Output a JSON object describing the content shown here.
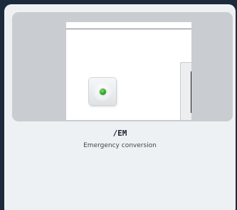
{
  "card": {
    "title": "/EM",
    "subtitle": "Emergency conversion",
    "indicator": {
      "state": "on",
      "color": "#2fa12a"
    }
  },
  "colors": {
    "background": "#1b2b3d",
    "card": "#eef1f3",
    "preview": "#c9cdd1"
  }
}
